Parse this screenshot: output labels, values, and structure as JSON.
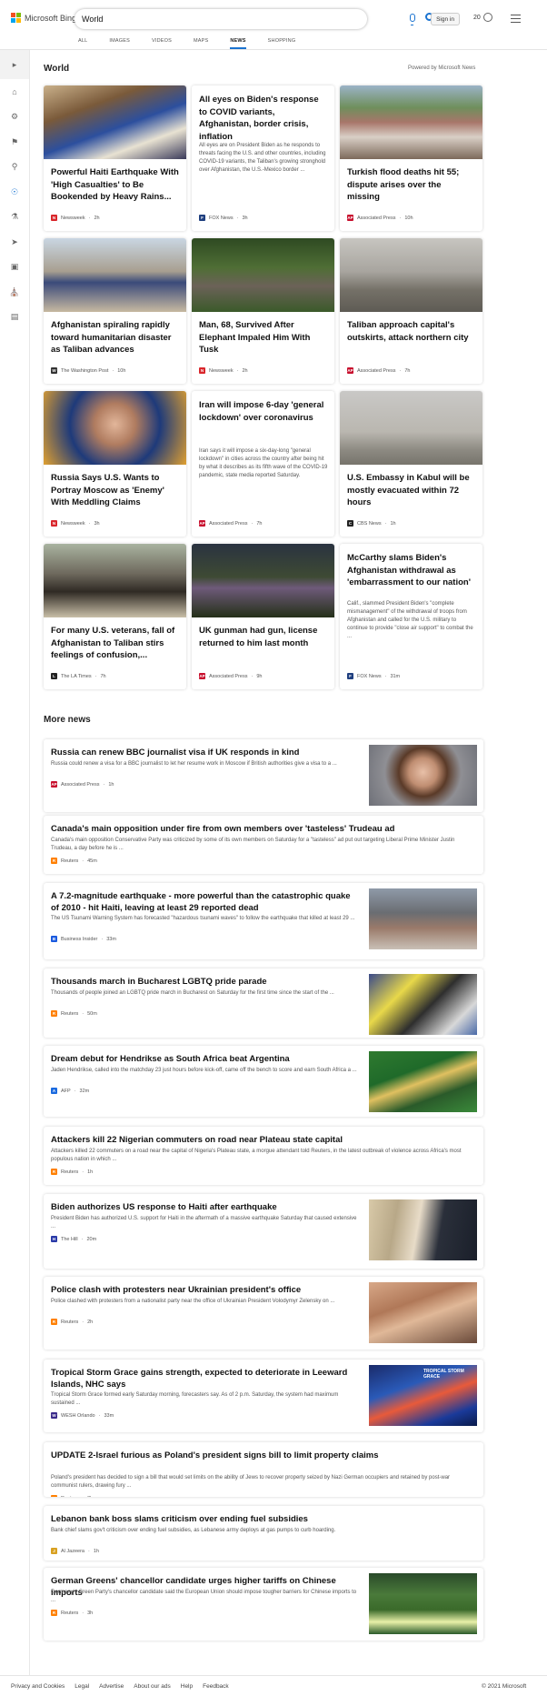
{
  "header": {
    "brand": "Microsoft Bing",
    "search_value": "World",
    "signin_label": "Sign in",
    "rewards_count": "20",
    "tabs": [
      "ALL",
      "IMAGES",
      "VIDEOS",
      "MAPS",
      "NEWS",
      "SHOPPING"
    ],
    "active_tab": "NEWS"
  },
  "colors": {
    "accent": "#1a73d0",
    "logo": [
      "#f25022",
      "#7fba00",
      "#00a4ef",
      "#ffb900"
    ]
  },
  "rail": {
    "icons": [
      "chevron-right-icon",
      "home-icon",
      "science-icon",
      "flag-icon",
      "location-icon",
      "globe-icon",
      "microscope-icon",
      "rocket-icon",
      "film-icon",
      "bank-icon",
      "credit-card-icon"
    ]
  },
  "main": {
    "section_title": "World",
    "powered_by": "Powered by Microsoft News",
    "more_title": "More news"
  },
  "cards": [
    {
      "title": "Powerful Haiti Earthquake With 'High Casualties' to Be Bookended by Heavy Rains...",
      "source": "Newsweek",
      "time": "2h",
      "img": "protest"
    },
    {
      "title": "All eyes on Biden's response to COVID variants, Afghanistan, border crisis, inflation",
      "snippet": "All eyes are on President Biden as he responds to threats facing the U.S. and other countries, including COVID-19 variants, the Taliban's growing stronghold over Afghanistan, the U.S.-Mexico border ...",
      "source": "FOX News",
      "time": "3h"
    },
    {
      "title": "Turkish flood deaths hit 55; dispute arises over the missing",
      "source": "Associated Press",
      "time": "10h",
      "img": "flood"
    },
    {
      "title": "Afghanistan spiraling rapidly toward humanitarian disaster as Taliban advances",
      "source": "The Washington Post",
      "time": "10h",
      "img": "refugees"
    },
    {
      "title": "Man, 68, Survived After Elephant Impaled Him With Tusk",
      "source": "Newsweek",
      "time": "2h",
      "img": "elephant"
    },
    {
      "title": "Taliban approach capital's outskirts, attack northern city",
      "source": "Associated Press",
      "time": "7h",
      "img": "city"
    },
    {
      "title": "Russia Says U.S. Wants to Portray Moscow as 'Enemy' With Meddling Claims",
      "source": "Newsweek",
      "time": "3h",
      "img": "diplomat"
    },
    {
      "title": "Iran will impose 6-day 'general lockdown' over coronavirus",
      "snippet": "Iran says it will impose a six-day-long \"general lockdown\" in cities across the country after being hit by what it describes as its fifth wave of the COVID-19 pandemic, state media reported Saturday.",
      "source": "Associated Press",
      "time": "7h"
    },
    {
      "title": "U.S. Embassy in Kabul will be mostly evacuated within 72 hours",
      "source": "CBS News",
      "time": "1h",
      "img": "kabul"
    },
    {
      "title": "For many U.S. veterans, fall of Afghanistan to Taliban stirs feelings of confusion,...",
      "source": "The LA Times",
      "time": "7h",
      "img": "soldier"
    },
    {
      "title": "UK gunman had gun, license returned to him last month",
      "source": "Associated Press",
      "time": "9h",
      "img": "mourners"
    },
    {
      "title": "McCarthy slams Biden's Afghanistan withdrawal as 'embarrassment to our nation'",
      "snippet": "Calif., slammed President Biden's \"complete mismanagement\" of the withdrawal of troops from Afghanistan and called for the U.S. military to continue to provide \"close air support\" to combat the ...",
      "source": "FOX News",
      "time": "31m"
    }
  ],
  "more_news": [
    {
      "title": "Russia can renew BBC journalist visa if UK responds in kind",
      "snippet": "Russia could renew a visa for a BBC journalist to let her resume work in Moscow if British authorities give a visa to a ...",
      "source": "Associated Press",
      "time": "1h",
      "img": "woman"
    },
    {
      "title": "Canada's main opposition under fire from own members over 'tasteless' Trudeau ad",
      "snippet": "Canada's main opposition Conservative Party was criticized by some of its own members on Saturday for a \"tasteless\" ad put out targeting Liberal Prime Minister Justin Trudeau, a day before he is ...",
      "source": "Reuters",
      "time": "45m"
    },
    {
      "title": "A 7.2-magnitude earthquake - more powerful than the catastrophic quake of 2010 - hit Haiti, leaving at least 29 reported dead",
      "snippet": "The US Tsunami Warning System has forecasted \"hazardous tsunami waves\" to follow the earthquake that killed at least 29 ...",
      "source": "Business Insider",
      "time": "33m",
      "img": "street"
    },
    {
      "title": "Thousands march in Bucharest LGBTQ pride parade",
      "snippet": "Thousands of people joined an LGBTQ pride march in Bucharest on Saturday for the first time since the start of the ...",
      "source": "Reuters",
      "time": "50m",
      "img": "pride"
    },
    {
      "title": "Dream debut for Hendrikse as South Africa beat Argentina",
      "snippet": "Jaden Hendrikse, called into the matchday 23 just hours before kick-off, came off the bench to score and earn South Africa a ...",
      "source": "AFP",
      "time": "32m",
      "img": "rugby"
    },
    {
      "title": "Attackers kill 22 Nigerian commuters on road near Plateau state capital",
      "snippet": "Attackers killed 22 commuters on a road near the capital of Nigeria's Plateau state, a morgue attendant told Reuters, in the latest outbreak of violence across Africa's most populous nation in which ...",
      "source": "Reuters",
      "time": "1h"
    },
    {
      "title": "Biden authorizes US response to Haiti after earthquake",
      "snippet": "President Biden has authorized U.S. support for Haiti in the aftermath of a massive earthquake Saturday that caused extensive ...",
      "source": "The Hill",
      "time": "20m",
      "img": "biden"
    },
    {
      "title": "Police clash with protesters near Ukrainian president's office",
      "snippet": "Police clashed with protesters from a nationalist party near the office of Ukrainian President Volodymyr Zelensky on ...",
      "source": "Reuters",
      "time": "2h",
      "img": "smoke"
    },
    {
      "title": "Tropical Storm Grace gains strength, expected to deteriorate in Leeward Islands, NHC says",
      "snippet": "Tropical Storm Grace formed early Saturday morning, forecasters say. As of 2 p.m. Saturday, the system had maximum sustained ...",
      "source": "WESH Orlando",
      "time": "33m",
      "img": "storm",
      "img_caption": "TROPICAL STORM GRACE"
    },
    {
      "title": "UPDATE 2-Israel furious as Poland's president signs bill to limit property claims",
      "snippet": "Poland's president has decided to sign a bill that would set limits on the ability of Jews to recover property seized by Nazi German occupiers and retained by post-war communist rulers, drawing fury ...",
      "source": "Reuters",
      "time": "3h"
    },
    {
      "title": "Lebanon bank boss slams criticism over ending fuel subsidies",
      "snippet": "Bank chief slams gov't criticism over ending fuel subsidies, as Lebanese army deploys at gas pumps to curb hoarding.",
      "source": "Al Jazeera",
      "time": "1h"
    },
    {
      "title": "German Greens' chancellor candidate urges higher tariffs on Chinese imports",
      "snippet": "Germany's Green Party's chancellor candidate said the European Union should impose tougher barriers for Chinese imports to ...",
      "source": "Reuters",
      "time": "3h",
      "img": "speaker"
    }
  ],
  "footer": {
    "links": [
      "Privacy and Cookies",
      "Legal",
      "Advertise",
      "About our ads",
      "Help",
      "Feedback"
    ],
    "copyright": "© 2021 Microsoft"
  }
}
